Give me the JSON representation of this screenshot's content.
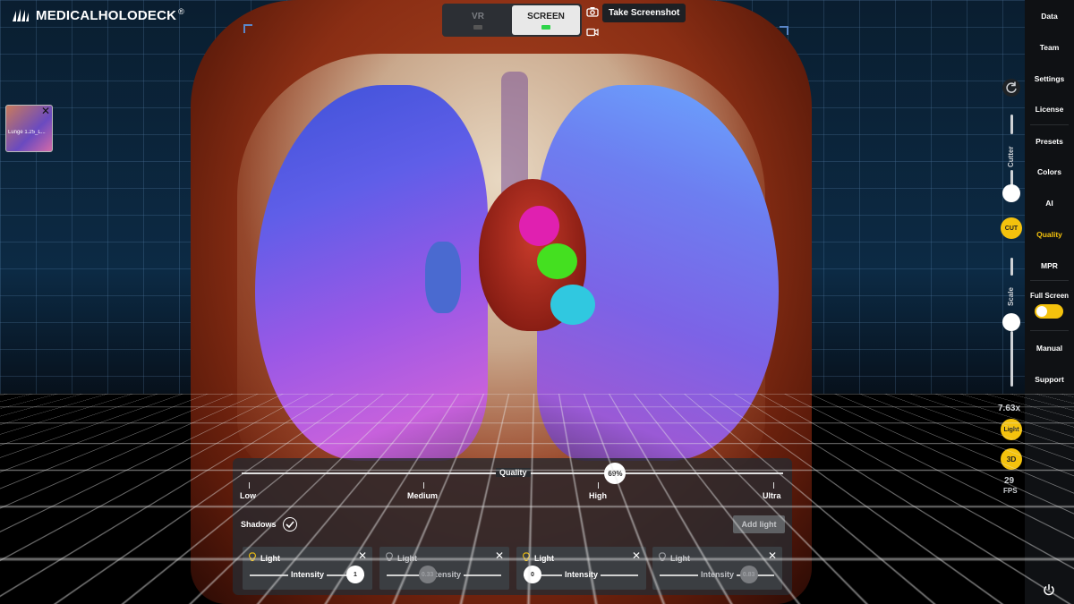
{
  "brand": {
    "name": "MEDICALHOLODECK",
    "reg": "®"
  },
  "dataset": {
    "label": "Lunge 1.25_L..."
  },
  "mode": {
    "vr": "VR",
    "screen": "SCREEN",
    "active": "SCREEN",
    "screenshot_label": "Take Screenshot"
  },
  "sidebar": {
    "items": [
      "Data",
      "Team",
      "Settings",
      "License",
      "Presets",
      "Colors",
      "AI",
      "Quality",
      "MPR",
      "Full Screen",
      "Manual",
      "Support"
    ],
    "active": "Quality",
    "full_screen_on": true
  },
  "controls": {
    "cutter_label": "Cutter",
    "cut_button": "CUT",
    "scale_label": "Scale",
    "zoom": "7.63x",
    "light_button": "Light",
    "view_3d_button": "3D",
    "fps_value": "29",
    "fps_label": "FPS"
  },
  "quality": {
    "title": "Quality",
    "value": "69%",
    "levels": [
      "Low",
      "Medium",
      "High",
      "Ultra"
    ],
    "shadows_label": "Shadows",
    "shadows_on": true,
    "add_light_label": "Add light"
  },
  "lights": [
    {
      "title": "Light",
      "slider_label": "Intensity",
      "value": "1",
      "enabled": true,
      "level": 1.0
    },
    {
      "title": "Light",
      "slider_label": "Intensity",
      "value": "0.33",
      "enabled": false,
      "level": 0.33
    },
    {
      "title": "Light",
      "slider_label": "Intensity",
      "value": "0",
      "enabled": true,
      "level": 0.0
    },
    {
      "title": "Light",
      "slider_label": "Intensity",
      "value": "0.83",
      "enabled": false,
      "level": 0.83
    }
  ],
  "colors": {
    "accent": "#f4c20d",
    "panel": "#282a2e",
    "sidebar": "#0f1114",
    "active_indicator": "#2ed44a"
  }
}
